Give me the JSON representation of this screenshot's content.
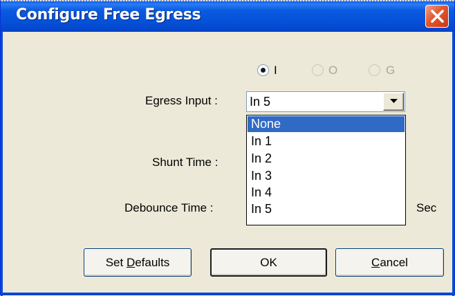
{
  "window": {
    "title": "Configure Free Egress"
  },
  "radio_group": [
    {
      "label": "I",
      "checked": true,
      "enabled": true
    },
    {
      "label": "O",
      "checked": false,
      "enabled": false
    },
    {
      "label": "G",
      "checked": false,
      "enabled": false
    }
  ],
  "fields": {
    "egress_input_label": "Egress Input :",
    "egress_input_value": "In 5",
    "shunt_time_label": "Shunt Time :",
    "debounce_time_label": "Debounce Time :",
    "sec_unit": "Sec"
  },
  "dropdown": {
    "options": [
      "None",
      "In 1",
      "In 2",
      "In 3",
      "In 4",
      "In 5"
    ],
    "highlighted": "None"
  },
  "buttons": {
    "set_defaults_prefix": "Set ",
    "set_defaults_mnemonic": "D",
    "set_defaults_suffix": "efaults",
    "ok": "OK",
    "cancel_mnemonic": "C",
    "cancel_suffix": "ancel"
  },
  "colors": {
    "titlebar": "#0450d6",
    "dialog_bg": "#ece9d8",
    "selection": "#316ac5",
    "close_button": "#e2572e"
  }
}
